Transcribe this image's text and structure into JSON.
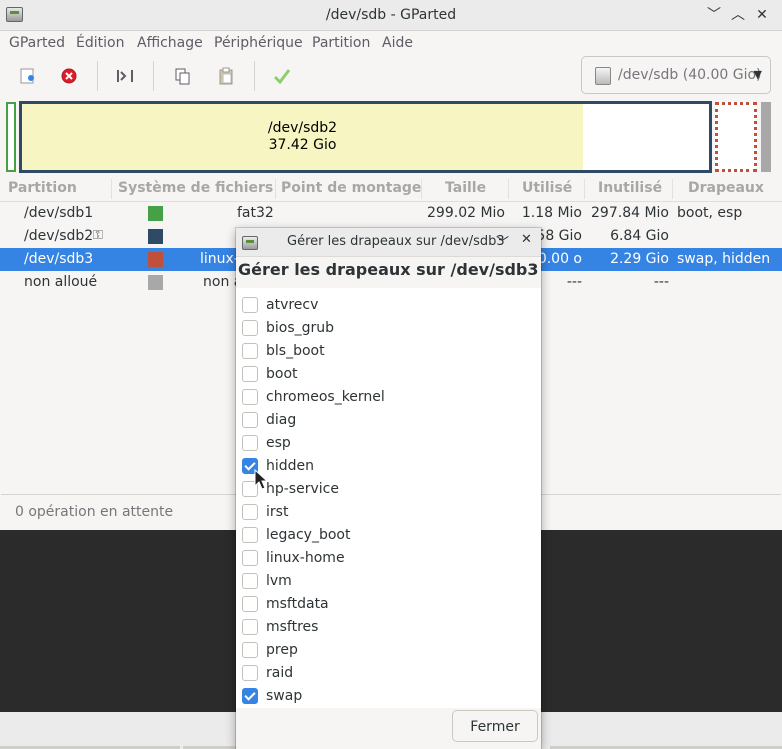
{
  "window": {
    "title": "/dev/sdb - GParted",
    "controls": {
      "minimize": "﹀",
      "maximize": "︿",
      "close": "✕"
    }
  },
  "menu": [
    "GParted",
    "Édition",
    "Affichage",
    "Périphérique",
    "Partition",
    "Aide"
  ],
  "toolbar": {
    "buttons": [
      "new-partition-icon",
      "delete-partition-icon",
      "resize-move-icon",
      "copy-icon",
      "paste-icon",
      "apply-icon"
    ],
    "device_selector": "/dev/sdb (40.00 Gio)"
  },
  "disk_map": {
    "sdb2_name": "/dev/sdb2",
    "sdb2_size": "37.42 Gio",
    "colors": {
      "fat32": "#46a046",
      "luks": "#2f4a67",
      "linux_swap": "#c0503c",
      "unallocated": "#a8a8a8",
      "used": "#f7f5c1"
    }
  },
  "table": {
    "columns": [
      "Partition",
      "Système de fichiers",
      "Point de montage",
      "Taille",
      "Utilisé",
      "Inutilisé",
      "Drapeaux"
    ],
    "rows": [
      {
        "partition": "/dev/sdb1",
        "fs": "fat32",
        "fs_color": "#46a046",
        "mount": "",
        "size": "299.02 Mio",
        "used": "1.18 Mio",
        "unused": "297.84 Mio",
        "flags": "boot, esp",
        "selected": false,
        "key": false
      },
      {
        "partition": "/dev/sdb2",
        "fs": "",
        "fs_color": "#2f4a67",
        "mount": "",
        "size": "",
        "used": "58 Gio",
        "unused": "6.84 Gio",
        "flags": "",
        "selected": false,
        "key": true
      },
      {
        "partition": "/dev/sdb3",
        "fs": "linux-",
        "fs_color": "#c0503c",
        "mount": "",
        "size": "",
        "used": "0.00 o",
        "unused": "2.29 Gio",
        "flags": "swap, hidden",
        "selected": true,
        "key": false
      },
      {
        "partition": "non alloué",
        "fs": "non a",
        "fs_color": "#a8a8a8",
        "mount": "",
        "size": "",
        "used": "---",
        "unused": "---",
        "flags": "",
        "selected": false,
        "key": false
      }
    ]
  },
  "status": "0 opération en attente",
  "dialog": {
    "title": "Gérer les drapeaux sur /dev/sdb3",
    "heading": "Gérer les drapeaux sur /dev/sdb3",
    "controls": {
      "minimize": "﹀",
      "close": "✕"
    },
    "flags": [
      {
        "name": "atvrecv",
        "checked": false
      },
      {
        "name": "bios_grub",
        "checked": false
      },
      {
        "name": "bls_boot",
        "checked": false
      },
      {
        "name": "boot",
        "checked": false
      },
      {
        "name": "chromeos_kernel",
        "checked": false
      },
      {
        "name": "diag",
        "checked": false
      },
      {
        "name": "esp",
        "checked": false
      },
      {
        "name": "hidden",
        "checked": true
      },
      {
        "name": "hp-service",
        "checked": false
      },
      {
        "name": "irst",
        "checked": false
      },
      {
        "name": "legacy_boot",
        "checked": false
      },
      {
        "name": "linux-home",
        "checked": false
      },
      {
        "name": "lvm",
        "checked": false
      },
      {
        "name": "msftdata",
        "checked": false
      },
      {
        "name": "msftres",
        "checked": false
      },
      {
        "name": "prep",
        "checked": false
      },
      {
        "name": "raid",
        "checked": false
      },
      {
        "name": "swap",
        "checked": true
      }
    ],
    "close_label": "Fermer"
  }
}
